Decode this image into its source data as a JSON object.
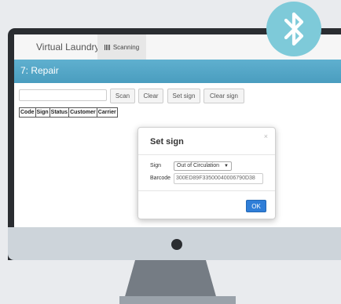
{
  "app": {
    "brand": "Virtual Laundry",
    "nav_tab": "Scanning",
    "page_title": "7: Repair"
  },
  "toolbar": {
    "scan_label": "Scan",
    "clear_label": "Clear",
    "set_sign_label": "Set sign",
    "clear_sign_label": "Clear sign",
    "input_value": ""
  },
  "table": {
    "columns": [
      "Code",
      "Sign",
      "Status",
      "Customer",
      "Carrier"
    ]
  },
  "modal": {
    "title": "Set sign",
    "close_glyph": "×",
    "sign_label": "Sign",
    "sign_value": "Out of Circulation",
    "barcode_label": "Barcode",
    "barcode_value": "300ED89F33500040006790D38",
    "ok_label": "OK"
  },
  "icons": {
    "nav_tab_icon": "barcode-icon",
    "badge_icon": "bluetooth-icon"
  },
  "colors": {
    "accent_blue": "#4a9dbf",
    "ok_blue": "#2f7ed8",
    "bluetooth_badge": "#7ecad9"
  }
}
